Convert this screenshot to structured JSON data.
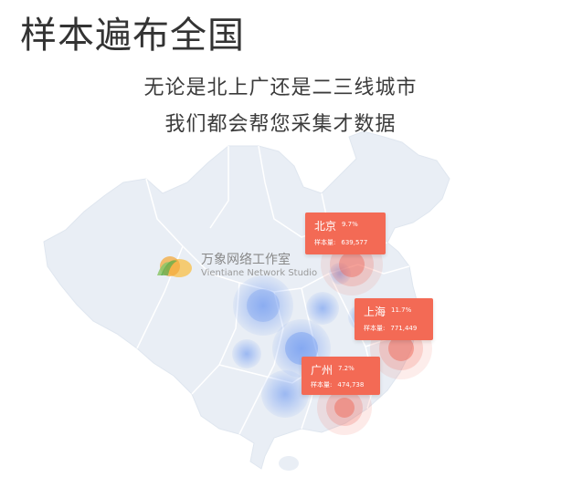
{
  "header": {
    "title": "样本遍布全国",
    "subtitle_1": "无论是北上广还是二三线城市",
    "subtitle_2": "我们都会帮您采集才数据"
  },
  "watermark": {
    "name_cn": "万象网络工作室",
    "name_en": "Vientiane Network Studio"
  },
  "callouts": [
    {
      "city": "北京",
      "percent": "9.7%",
      "sample_label": "样本量:",
      "sample_value": "639,577"
    },
    {
      "city": "上海",
      "percent": "11.7%",
      "sample_label": "样本量:",
      "sample_value": "771,449"
    },
    {
      "city": "广州",
      "percent": "7.2%",
      "sample_label": "样本量:",
      "sample_value": "474,738"
    }
  ],
  "colors": {
    "map_fill": "#e9eef5",
    "map_border": "#ffffff",
    "callout_bg": "#f36a55",
    "highlight_red": "#f0695a",
    "bubble_blue": "#5b8cf0"
  }
}
